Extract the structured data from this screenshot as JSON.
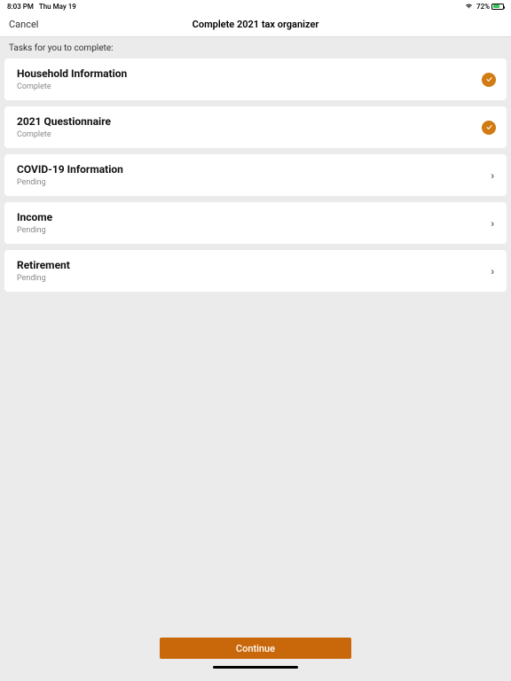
{
  "status": {
    "time": "8:03 PM",
    "date": "Thu May 19",
    "battery_pct": "72%"
  },
  "nav": {
    "cancel_label": "Cancel",
    "title": "Complete 2021 tax organizer"
  },
  "tasks_label": "Tasks for you to complete:",
  "tasks": [
    {
      "title": "Household Information",
      "status": "Complete",
      "done": true
    },
    {
      "title": "2021 Questionnaire",
      "status": "Complete",
      "done": true
    },
    {
      "title": "COVID-19 Information",
      "status": "Pending",
      "done": false
    },
    {
      "title": "Income",
      "status": "Pending",
      "done": false
    },
    {
      "title": "Retirement",
      "status": "Pending",
      "done": false
    }
  ],
  "continue_label": "Continue",
  "colors": {
    "accent": "#c9680a",
    "badge": "#d17b13",
    "bg": "#ebebeb"
  }
}
